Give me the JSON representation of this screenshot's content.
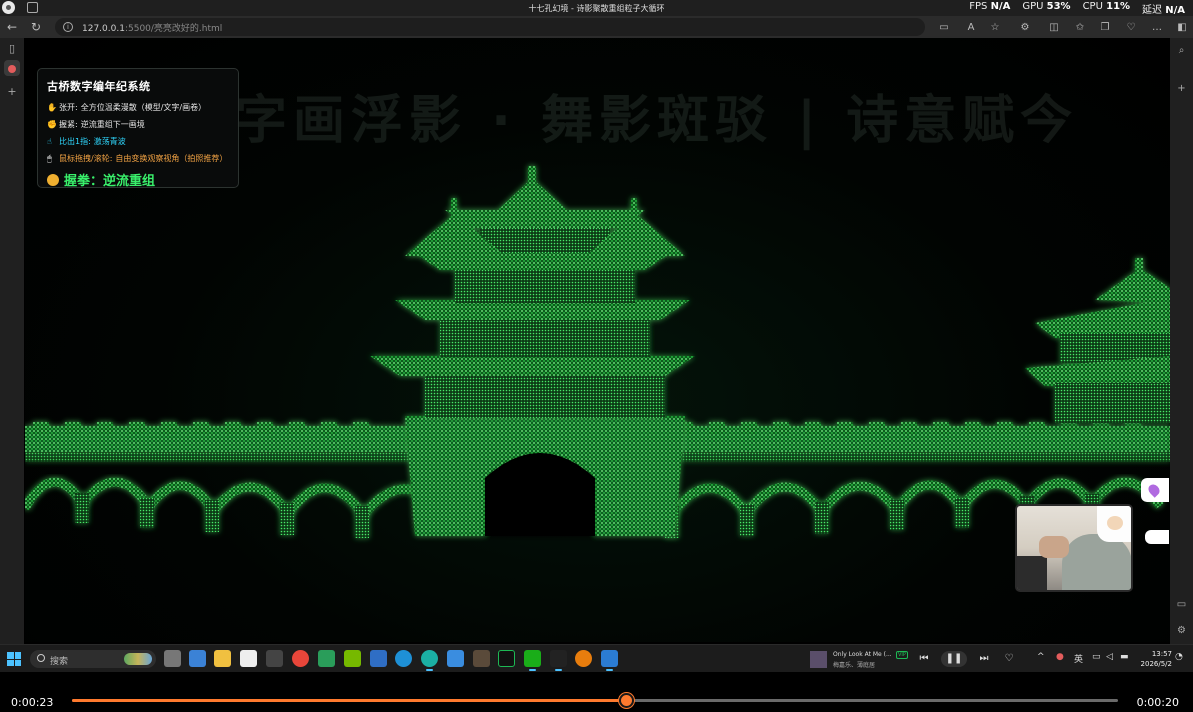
{
  "titlebar": {
    "tab_title": "十七孔幻境 - 诗影聚散重组粒子大循环",
    "fps_label": "FPS",
    "fps_value": "N/A",
    "gpu_label": "GPU",
    "gpu_value": "53%",
    "cpu_label": "CPU",
    "cpu_value": "11%",
    "extra_label": "延迟",
    "extra_value": "N/A"
  },
  "addressbar": {
    "url_host": "127.0.0.1",
    "url_path": ":5500/亮亮改好的.html"
  },
  "panel": {
    "title": "古桥数字编年纪系统",
    "rows": [
      {
        "icon": "✋",
        "label": "张开:",
        "text": "全方位温柔漫散（模型/文字/画卷）"
      },
      {
        "icon": "✊",
        "label": "握紧:",
        "text": "逆流重组下一画境"
      },
      {
        "icon": "☝",
        "label": "比出1指:",
        "text": "激荡青波"
      },
      {
        "icon": "🖱",
        "label": "鼠标拖拽/滚轮:",
        "text": "自由变换观察视角（拍照推荐）"
      }
    ],
    "status": "握拳：逆流重组"
  },
  "scene": {
    "ghost_text": "字画浮影 · 舞影斑驳 | 诗意赋今",
    "particle_color": "#39ff5a"
  },
  "taskbar": {
    "search_placeholder": "搜索",
    "media_title": "Only Look At Me (...",
    "media_artist": "梅嘉乐、薄庭居",
    "media_badge": "VIP",
    "ime": "英",
    "time": "13:57",
    "date": "2026/5/2"
  },
  "player": {
    "current_time": "0:00:23",
    "duration": "0:00:20",
    "progress": 0.53
  }
}
